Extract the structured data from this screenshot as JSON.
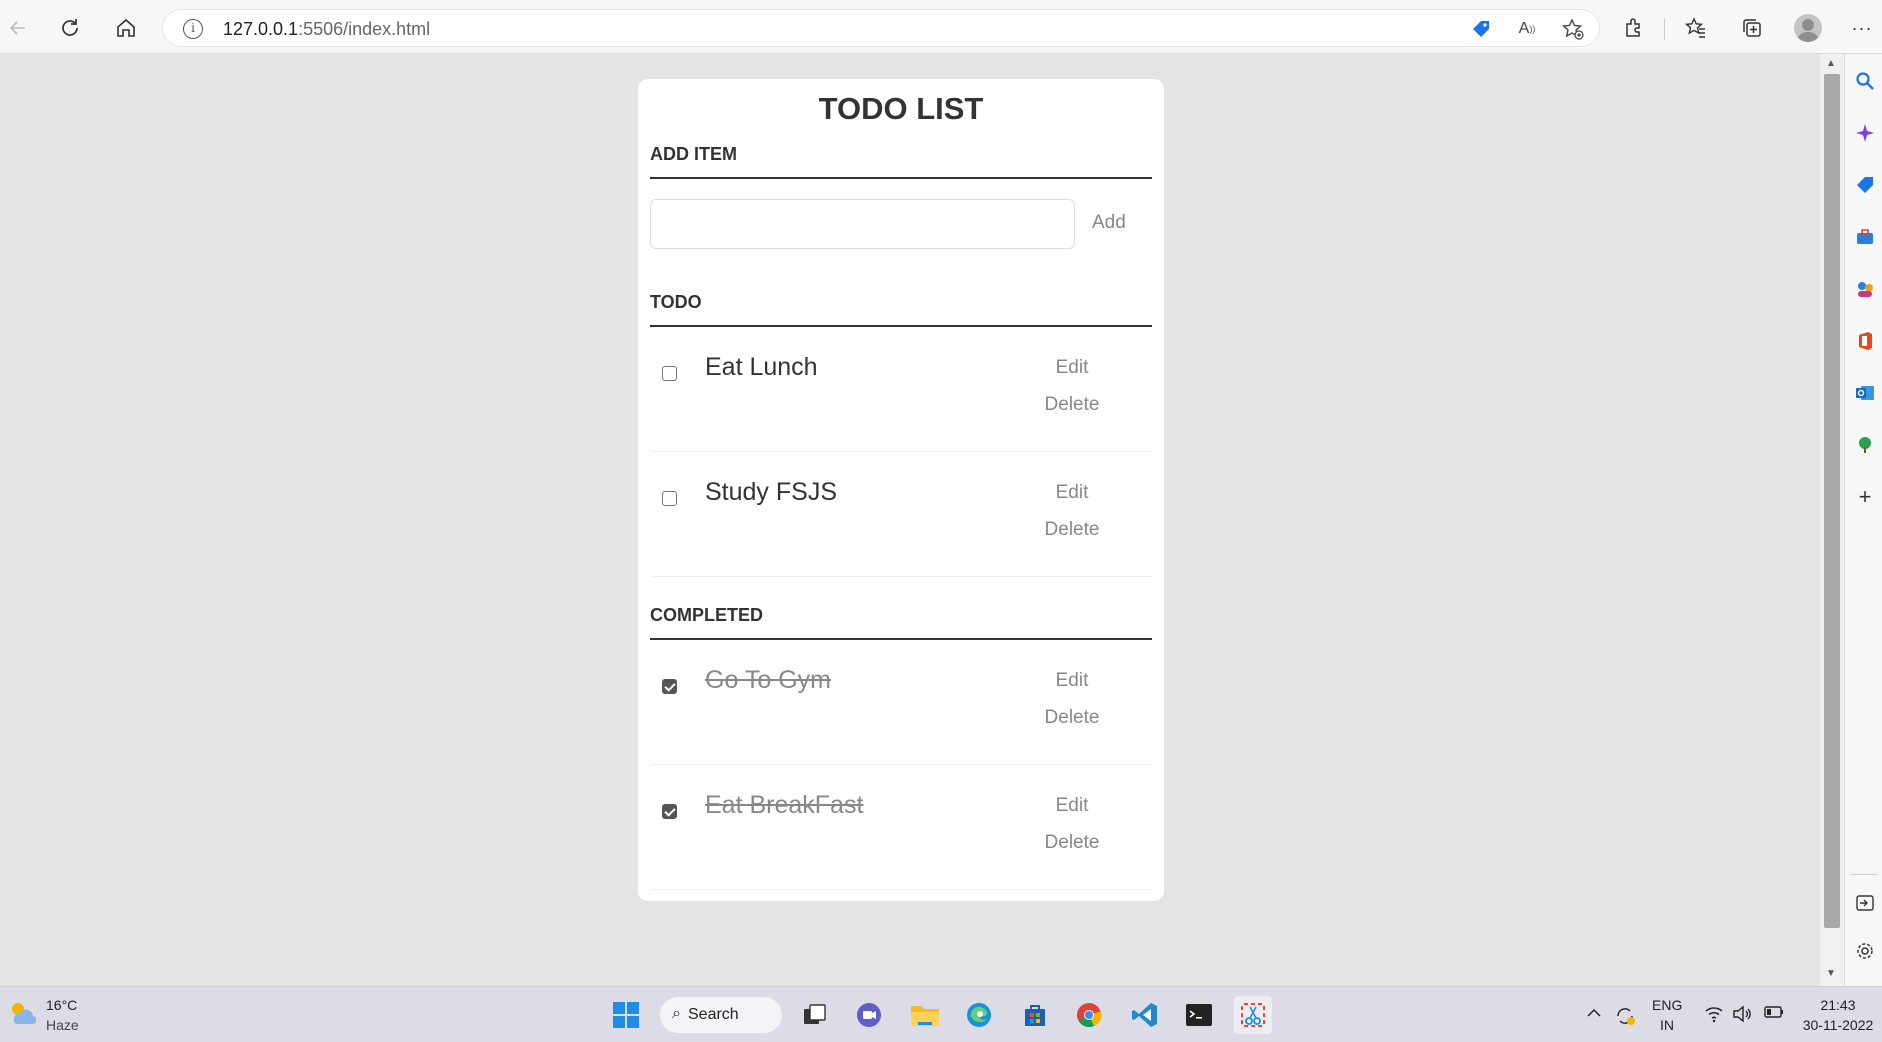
{
  "browser": {
    "url_host": "127.0.0.1",
    "url_path": ":5506/index.html"
  },
  "app": {
    "title": "TODO LIST",
    "add_section": {
      "title": "ADD ITEM",
      "input_value": "",
      "add_label": "Add"
    },
    "todo_section": {
      "title": "TODO",
      "items": [
        {
          "label": "Eat Lunch",
          "checked": false,
          "edit_label": "Edit",
          "delete_label": "Delete"
        },
        {
          "label": "Study FSJS",
          "checked": false,
          "edit_label": "Edit",
          "delete_label": "Delete"
        }
      ]
    },
    "completed_section": {
      "title": "COMPLETED",
      "items": [
        {
          "label": "Go To Gym",
          "checked": true,
          "edit_label": "Edit",
          "delete_label": "Delete"
        },
        {
          "label": "Eat BreakFast",
          "checked": true,
          "edit_label": "Edit",
          "delete_label": "Delete"
        }
      ]
    }
  },
  "taskbar": {
    "weather_temp": "16°C",
    "weather_desc": "Haze",
    "search_label": "Search",
    "lang_top": "ENG",
    "lang_bottom": "IN",
    "time": "21:43",
    "date": "30-11-2022"
  },
  "colors": {
    "page_bg": "#e4e4e4",
    "card_bg": "#ffffff",
    "muted_text": "#888888"
  }
}
